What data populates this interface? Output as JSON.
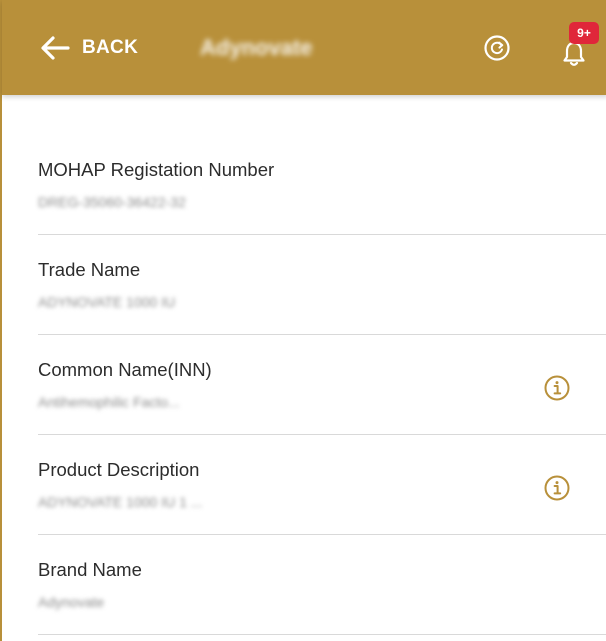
{
  "header": {
    "back_label": "BACK",
    "title": "Adynovate",
    "notification_badge": "9+",
    "bar_color": "#b8903a",
    "badge_color": "#e0263a",
    "icons": [
      "arrow-left-icon",
      "refresh-icon",
      "bell-icon"
    ]
  },
  "details": [
    {
      "label": "MOHAP Registation Number",
      "value": "DREG-35060-36422-32",
      "has_info": false
    },
    {
      "label": "Trade Name",
      "value": "ADYNOVATE 1000 IU",
      "has_info": false
    },
    {
      "label": "Common Name(INN)",
      "value": "Antihemophilic Facto...",
      "has_info": true
    },
    {
      "label": "Product Description",
      "value": "ADYNOVATE 1000 IU 1 ...",
      "has_info": true
    },
    {
      "label": "Brand Name",
      "value": "Adynovate",
      "has_info": false
    }
  ],
  "colors": {
    "accent": "#b8903a",
    "label_text": "#2c2c2c",
    "value_text": "#8c8c8c",
    "divider": "#d9d9d9"
  }
}
